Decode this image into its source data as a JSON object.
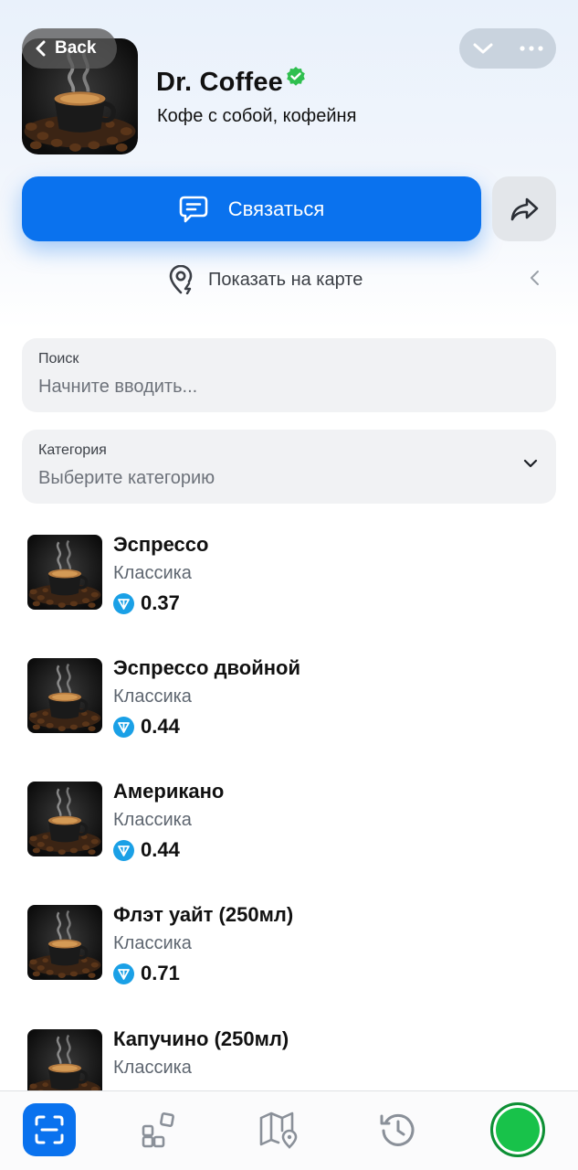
{
  "header": {
    "back_label": "Back",
    "store_name": "Dr. Coffee",
    "store_subtitle": "Кофе с собой, кофейня",
    "contact_label": "Связаться",
    "map_label": "Показать на карте"
  },
  "search": {
    "label": "Поиск",
    "placeholder": "Начните вводить..."
  },
  "category": {
    "label": "Категория",
    "placeholder": "Выберите категорию"
  },
  "items": [
    {
      "name": "Эспрессо",
      "category": "Классика",
      "price": "0.37"
    },
    {
      "name": "Эспрессо двойной",
      "category": "Классика",
      "price": "0.44"
    },
    {
      "name": "Американо",
      "category": "Классика",
      "price": "0.44"
    },
    {
      "name": "Флэт уайт (250мл)",
      "category": "Классика",
      "price": "0.71"
    },
    {
      "name": "Капучино (250мл)",
      "category": "Классика",
      "price": ""
    }
  ],
  "colors": {
    "accent": "#0a72ee",
    "verified": "#2fbf4f",
    "ton": "#1aa0e6",
    "status": "#18c24a"
  },
  "tabbar": [
    "scan-icon",
    "apps-icon",
    "map-icon",
    "history-icon",
    "status-indicator"
  ]
}
